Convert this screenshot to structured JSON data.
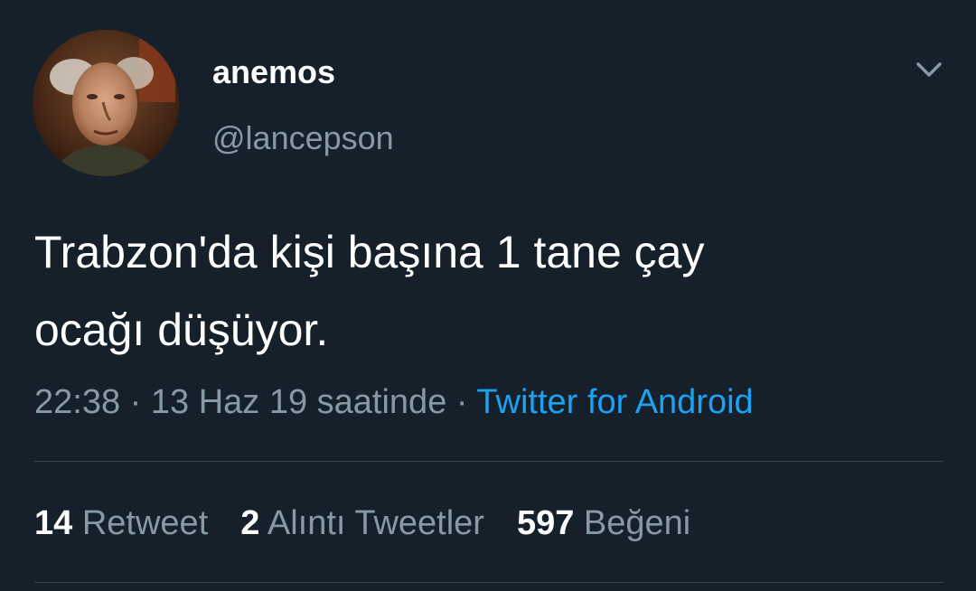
{
  "author": {
    "display_name": "anemos",
    "handle": "@lancepson",
    "avatar_icon": "profile-photo"
  },
  "menu": {
    "icon": "chevron-down-icon"
  },
  "tweet": {
    "lines": [
      "Trabzon'da kişi başına 1 tane çay",
      "ocağı düşüyor."
    ],
    "time": "22:38",
    "separator": "·",
    "date_text": "13 Haz 19 saatinde",
    "source": "Twitter for Android"
  },
  "stats": {
    "retweets": {
      "count": "14",
      "label": "Retweet"
    },
    "quotes": {
      "count": "2",
      "label": "Alıntı Tweetler"
    },
    "likes": {
      "count": "597",
      "label": "Beğeni"
    }
  },
  "colors": {
    "background": "#15202b",
    "secondary_text": "#8899a6",
    "link": "#1da1f2",
    "divider": "#38444d"
  }
}
